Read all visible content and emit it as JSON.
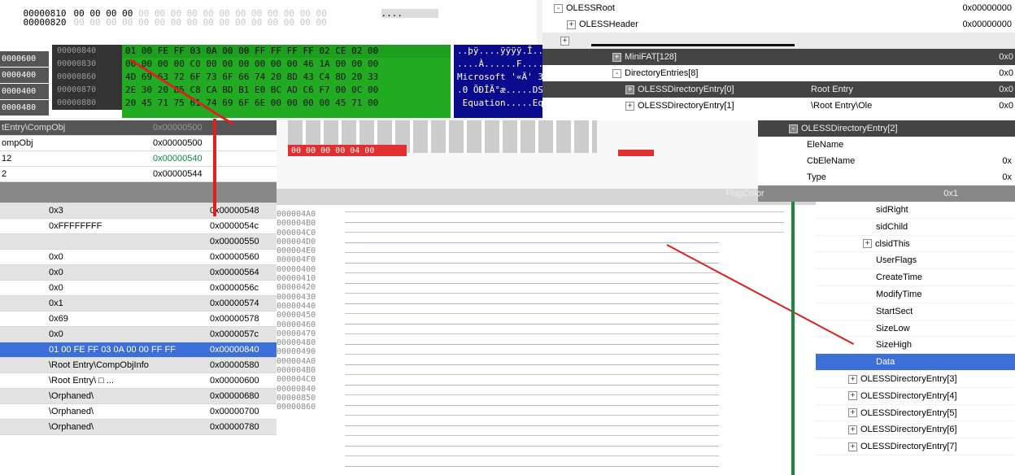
{
  "hex_top": {
    "rows": [
      {
        "offset": "00000810",
        "bytes": "00 00 00 00",
        "ascii": "...."
      },
      {
        "offset": "00000820",
        "bytes": "",
        "ascii": ""
      }
    ]
  },
  "inner_hex": {
    "offsets_left": [
      "0000600",
      "0000400",
      "0000400",
      "0000480"
    ],
    "offsets_inner": [
      "00000840",
      "00000830",
      "00000860",
      "00000870",
      "00000880"
    ],
    "byte_rows": [
      "01 00 FE FF 03 0A 00 00 FF FF FF FF 02 CE 02 00",
      "00 00 00 00 C0 00 00 00 00 00 00 46 1A 00 00 00",
      "4D 69 63 72 6F 73 6F 66 74 20 8D 43 C4 8D 20 33",
      "2E 30 20 B5 C8 CA BD B1 E0 BC AD C6 F7 00 0C 00",
      "20 45 71 75 61 74 69 6F 6E 00 00 00 00 45 71 00"
    ],
    "ascii_rows": [
      "..þÿ....ÿÿÿÿ.Î..",
      "....À......F....",
      "Microsoft '«Ä' 3",
      ".0 ÕÐÎÃ°æ.....DS",
      " Equation.....Eq"
    ]
  },
  "tree_top": {
    "items": [
      {
        "name": "OLESSRoot",
        "value": "0x00000000",
        "toggle": "-"
      },
      {
        "name": "OLESSHeader",
        "value": "0x00000000",
        "toggle": "+"
      },
      {
        "name": "",
        "value": "",
        "toggle": "+"
      },
      {
        "name": "MiniFAT[128]",
        "value": "0x0",
        "toggle": "+"
      },
      {
        "name": "DirectoryEntries[8]",
        "value": "0x0",
        "toggle": "-"
      },
      {
        "name": "OLESSDirectoryEntry[0]",
        "value": "0x0",
        "extra": "Root Entry",
        "toggle": "+"
      },
      {
        "name": "OLESSDirectoryEntry[1]",
        "value": "0x0",
        "extra": "\\Root Entry\\Ole",
        "toggle": "+"
      }
    ]
  },
  "mid_tree": {
    "header": "OLESSDirectoryEntry[2]",
    "items": [
      "EleName",
      "CbEleName",
      "Type",
      "FlagColor"
    ],
    "values": [
      "",
      "0x",
      "0x",
      "0x1"
    ]
  },
  "left_table": {
    "top_rows": [
      {
        "name": "tEntry\\CompObj",
        "value": "0x00000500"
      },
      {
        "name": "ompObj",
        "value": "0x00000500"
      },
      {
        "name": "12",
        "value": "0x00000540"
      },
      {
        "name": "2",
        "value": "0x00000544"
      }
    ],
    "rows": [
      {
        "name": "0x3",
        "offset": "0x00000548",
        "style": "grey"
      },
      {
        "name": "0xFFFFFFFF",
        "offset": "0x0000054c",
        "style": "white"
      },
      {
        "name": "",
        "offset": "0x00000550",
        "style": "grey"
      },
      {
        "name": "0x0",
        "offset": "0x00000560",
        "style": "white"
      },
      {
        "name": "0x0",
        "offset": "0x00000564",
        "style": "grey"
      },
      {
        "name": "0x0",
        "offset": "0x0000056c",
        "style": "white"
      },
      {
        "name": "0x1",
        "offset": "0x00000574",
        "style": "grey"
      },
      {
        "name": "0x69",
        "offset": "0x00000578",
        "style": "white"
      },
      {
        "name": "0x0",
        "offset": "0x0000057c",
        "style": "grey"
      },
      {
        "name": "01 00 FE FF 03 0A 00 00 FF FF",
        "offset": "0x00000840",
        "style": "sel"
      },
      {
        "name": "\\Root Entry\\CompObjInfo",
        "offset": "0x00000580",
        "style": "grey"
      },
      {
        "name": "\\Root Entry\\     □        ...",
        "offset": "0x00000600",
        "style": "white"
      },
      {
        "name": "\\Orphaned\\",
        "offset": "0x00000680",
        "style": "grey"
      },
      {
        "name": "\\Orphaned\\",
        "offset": "0x00000700",
        "style": "white"
      },
      {
        "name": "\\Orphaned\\",
        "offset": "0x00000780",
        "style": "grey"
      }
    ]
  },
  "mid_offsets": [
    "000004A0",
    "000004B0",
    "000004C0",
    "000004D0",
    "000004E0",
    "000004F0",
    "00000400",
    "00000410",
    "00000420",
    "00000430",
    "00000440",
    "00000450",
    "00000460",
    "00000470",
    "00000480",
    "00000490",
    "000004A0",
    "000004B0",
    "000004C0",
    "00000840",
    "00000850",
    "00000860"
  ],
  "red_field": "00 00 00 00 04 00",
  "tree_right": {
    "items": [
      {
        "name": "sidRight",
        "toggle": ""
      },
      {
        "name": "sidChild",
        "toggle": ""
      },
      {
        "name": "clsidThis",
        "toggle": "+"
      },
      {
        "name": "UserFlags",
        "toggle": ""
      },
      {
        "name": "CreateTime",
        "toggle": ""
      },
      {
        "name": "ModifyTime",
        "toggle": ""
      },
      {
        "name": "StartSect",
        "toggle": ""
      },
      {
        "name": "SizeLow",
        "toggle": ""
      },
      {
        "name": "SizeHigh",
        "toggle": ""
      },
      {
        "name": "Data",
        "toggle": "",
        "selected": true
      },
      {
        "name": "OLESSDirectoryEntry[3]",
        "toggle": "+"
      },
      {
        "name": "OLESSDirectoryEntry[4]",
        "toggle": "+"
      },
      {
        "name": "OLESSDirectoryEntry[5]",
        "toggle": "+"
      },
      {
        "name": "OLESSDirectoryEntry[6]",
        "toggle": "+"
      },
      {
        "name": "OLESSDirectoryEntry[7]",
        "toggle": "+"
      }
    ]
  },
  "colors": {
    "selection": "#3c6fd8",
    "hex_green": "#22aa22",
    "ascii_blue": "#0a0a8c",
    "arrow_red": "#e02020"
  }
}
